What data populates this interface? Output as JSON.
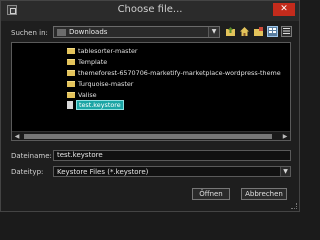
{
  "window": {
    "title": "Choose file..."
  },
  "lookin": {
    "label": "Suchen in:",
    "value": "Downloads"
  },
  "files": [
    {
      "name": "tablesorter-master",
      "kind": "folder"
    },
    {
      "name": "Template",
      "kind": "folder"
    },
    {
      "name": "themeforest-6570706-marketify-marketplace-wordpress-theme",
      "kind": "folder"
    },
    {
      "name": "Turquoise-master",
      "kind": "folder"
    },
    {
      "name": "Valise",
      "kind": "folder"
    },
    {
      "name": "test.keystore",
      "kind": "file",
      "selected": true
    }
  ],
  "filename": {
    "label": "Dateiname:",
    "value": "test.keystore"
  },
  "filetype": {
    "label": "Dateityp:",
    "value": "Keystore Files (*.keystore)"
  },
  "buttons": {
    "open": "Öffnen",
    "cancel": "Abbrechen"
  },
  "icons": {
    "folder_up": "folder-up-icon",
    "home": "home-icon",
    "new_folder": "new-folder-icon",
    "list_view": "list-view-icon",
    "details_view": "details-view-icon"
  },
  "colors": {
    "selection": "#1aa5a5",
    "close": "#c42b1c",
    "folder": "#e3c35b"
  }
}
